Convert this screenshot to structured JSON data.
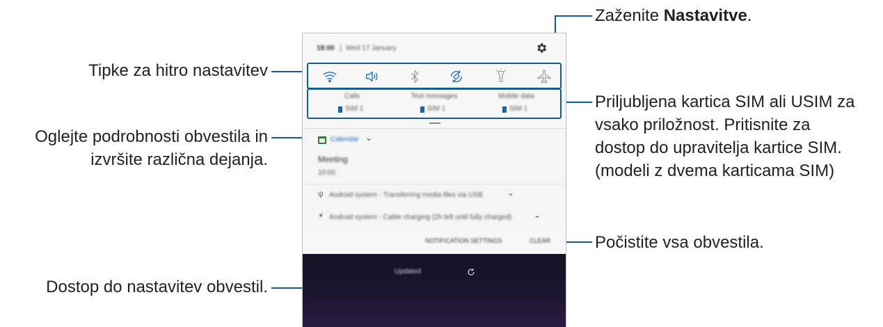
{
  "callouts": {
    "settings_prefix": "Zaženite ",
    "settings_bold": "Nastavitve",
    "settings_suffix": ".",
    "quick_settings": "Tipke za hitro nastavitev",
    "notif_details_1": "Oglejte podrobnosti obvestila in",
    "notif_details_2": "izvršite različna dejanja.",
    "sim_1": "Priljubljena kartica SIM ali USIM za",
    "sim_2": "vsako priložnost. Pritisnite za",
    "sim_3": "dostop do upravitelja kartice SIM.",
    "sim_4": "(modeli z dvema karticama SIM)",
    "clear_all": "Počistite vsa obvestila.",
    "notif_settings": "Dostop do nastavitev obvestil."
  },
  "panel": {
    "status_time": "18:00",
    "status_date": "Wed 17 January",
    "quick_icons": [
      "wifi-icon",
      "sound-icon",
      "bluetooth-icon",
      "auto-rotate-icon",
      "flashlight-icon",
      "airplane-mode-icon"
    ],
    "sim_columns": [
      {
        "title": "Calls",
        "sim": "SIM 1"
      },
      {
        "title": "Text messages",
        "sim": "SIM 1"
      },
      {
        "title": "Mobile data",
        "sim": "SIM 1"
      }
    ],
    "notification": {
      "app": "Calendar",
      "title": "Meeting",
      "time": "10:00"
    },
    "system_notifications": [
      "Android system · Transferring media files via USB",
      "Android system · Cable charging (2h left until fully charged)"
    ],
    "notification_settings_button": "NOTIFICATION SETTINGS",
    "clear_button": "CLEAR",
    "lock_status": "Updated"
  },
  "colors": {
    "accent_blue": "#0a5e9e",
    "text": "#231f20"
  }
}
